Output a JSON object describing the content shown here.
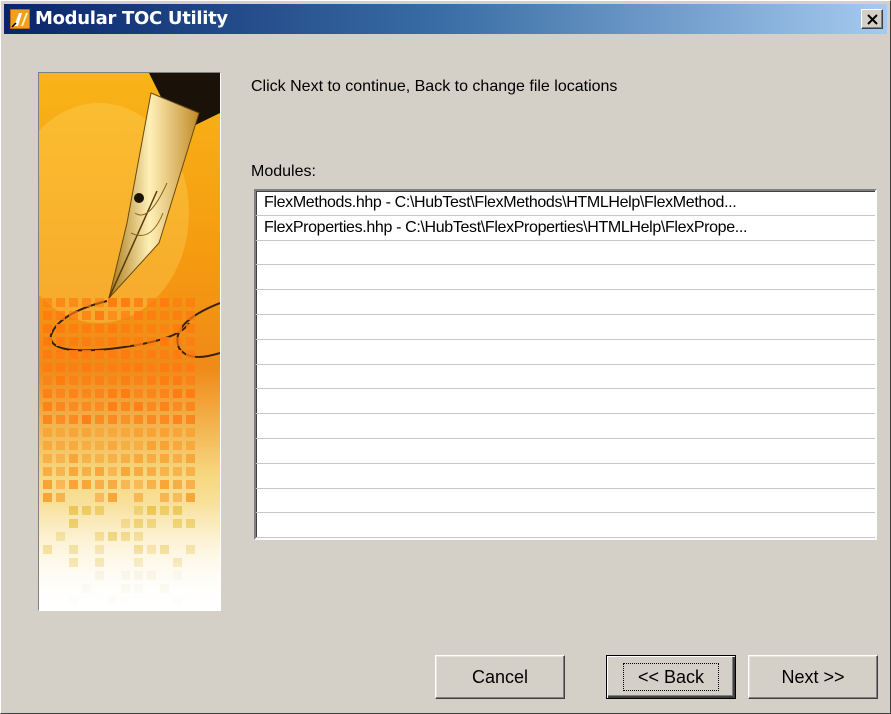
{
  "window": {
    "title": "Modular TOC Utility",
    "title_gradient": [
      "#0a246a",
      "#a6caf0"
    ],
    "face_color": "#d4d0c8"
  },
  "instruction_text": "Click Next to continue, Back to change file locations",
  "modules": {
    "label": "Modules:",
    "items": [
      "FlexMethods.hhp - C:\\HubTest\\FlexMethods\\HTMLHelp\\FlexMethod...",
      "FlexProperties.hhp - C:\\HubTest\\FlexProperties\\HTMLHelp\\FlexPrope...",
      "",
      "",
      "",
      "",
      "",
      "",
      "",
      "",
      "",
      "",
      "",
      ""
    ]
  },
  "buttons": {
    "cancel": "Cancel",
    "back": "<< Back",
    "next": "Next >>"
  },
  "icons": {
    "app": "pen-nib-icon",
    "close": "close-icon",
    "side_image": "fountain-pen-artwork"
  }
}
